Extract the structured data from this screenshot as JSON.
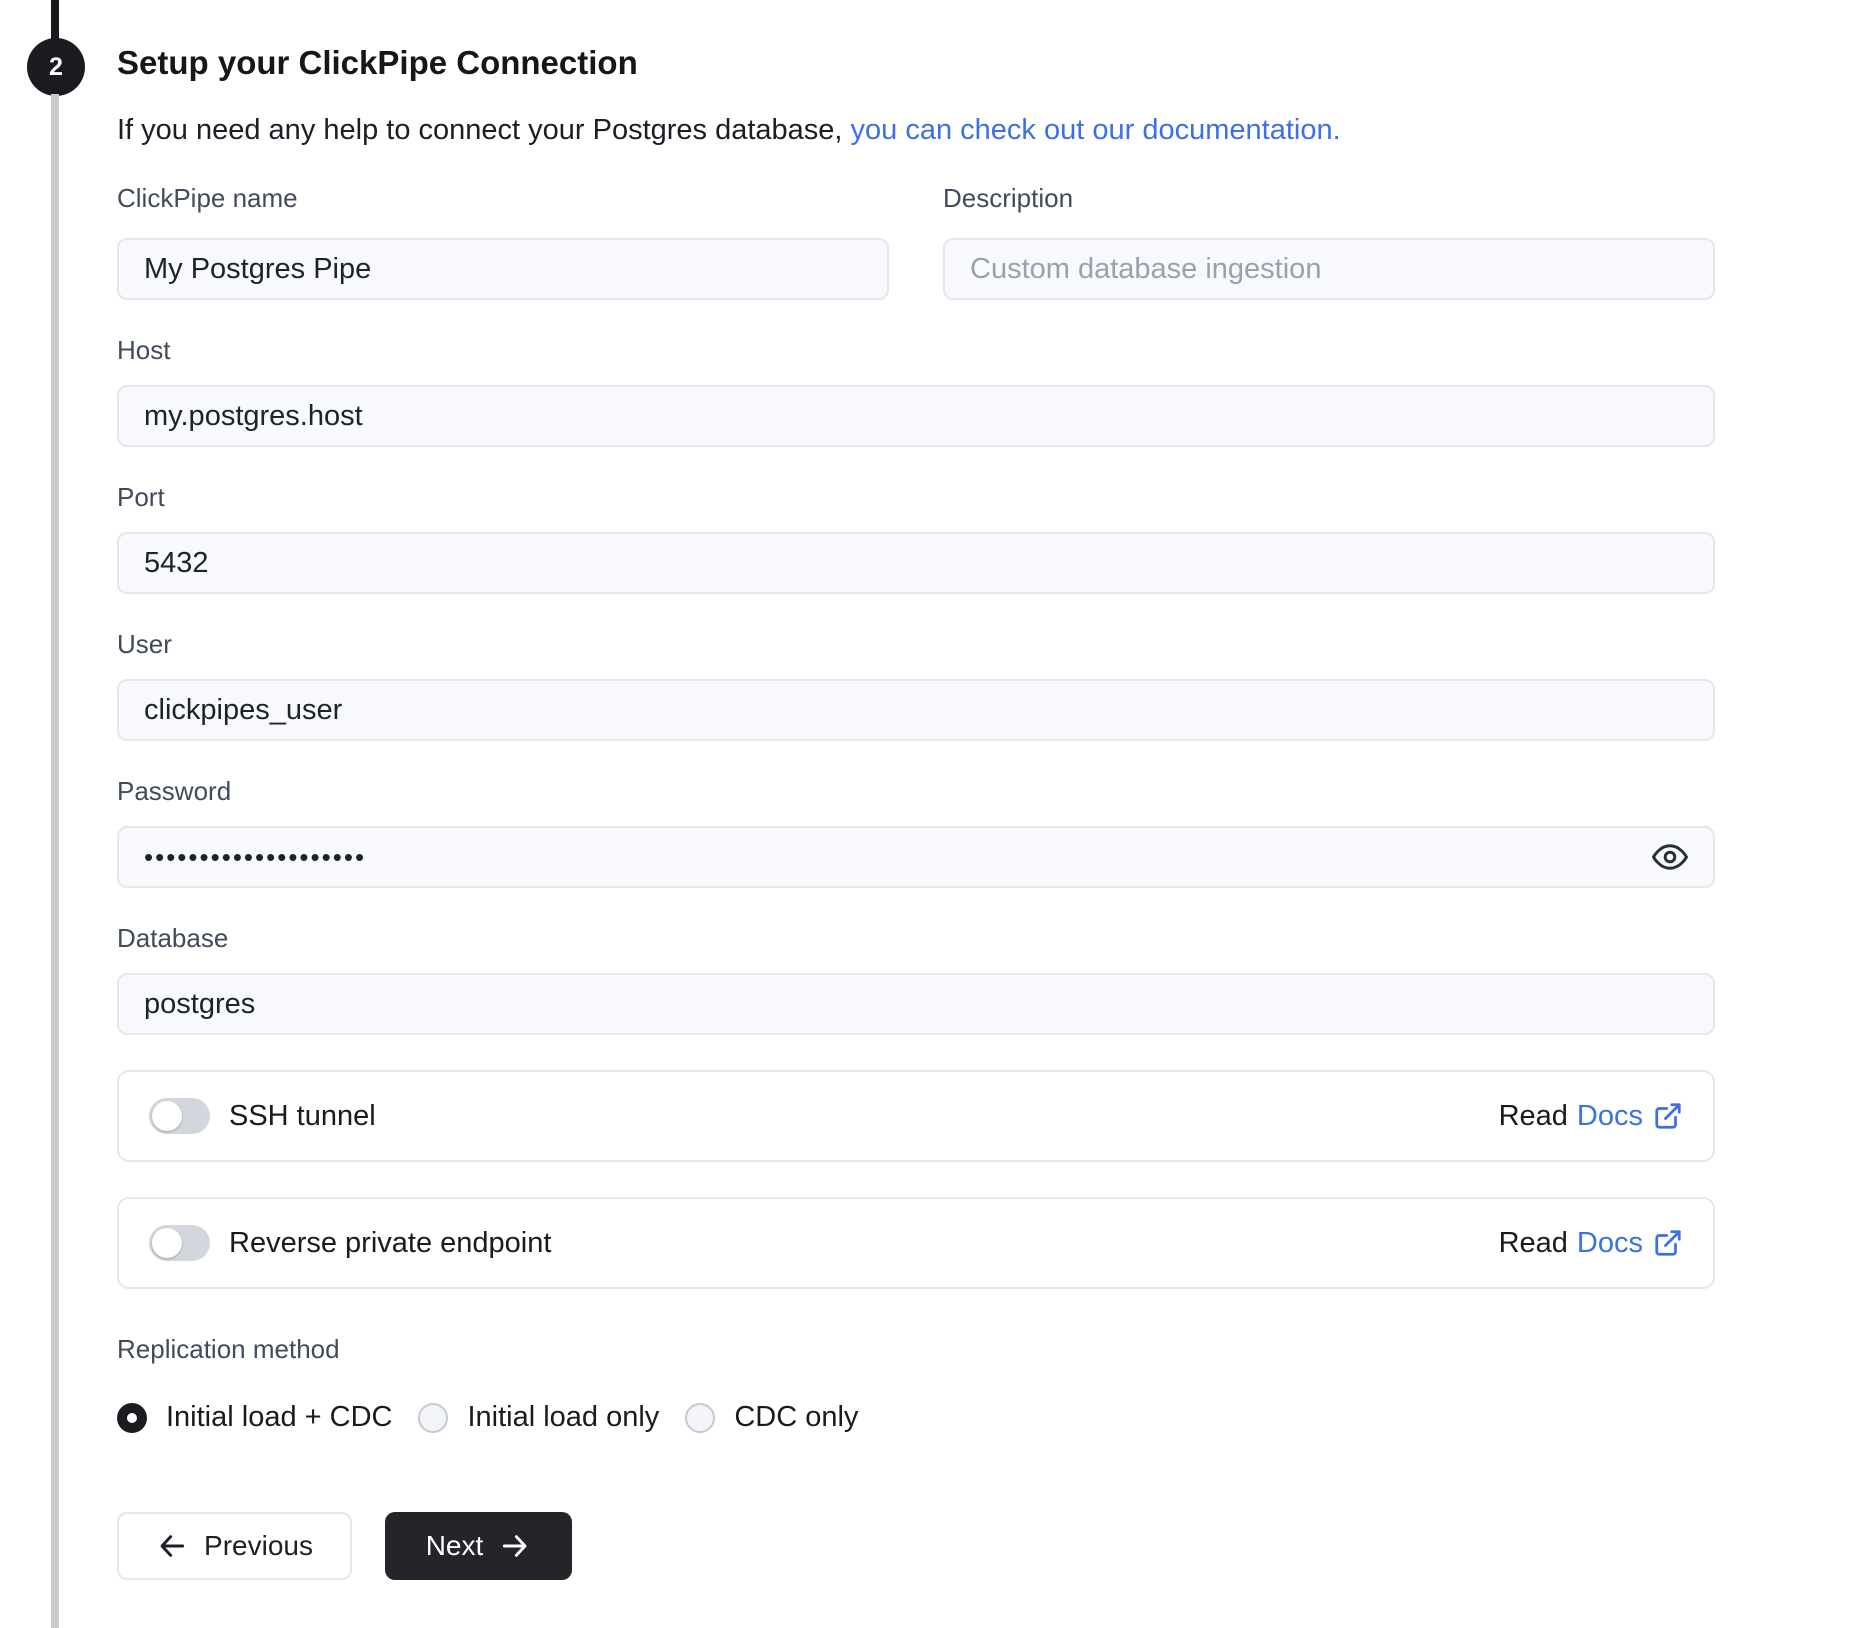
{
  "step": {
    "number": "2"
  },
  "header": {
    "title": "Setup your ClickPipe Connection",
    "subtitle_plain": "If you need any help to connect your Postgres database, ",
    "subtitle_link": "you can check out our documentation."
  },
  "fields": {
    "clickpipe_name": {
      "label": "ClickPipe name",
      "value": "My Postgres Pipe"
    },
    "description": {
      "label": "Description",
      "placeholder": "Custom database ingestion"
    },
    "host": {
      "label": "Host",
      "value": "my.postgres.host"
    },
    "port": {
      "label": "Port",
      "value": "5432"
    },
    "user": {
      "label": "User",
      "value": "clickpipes_user"
    },
    "password": {
      "label": "Password",
      "masked_value": "••••••••••••••••••••"
    },
    "database": {
      "label": "Database",
      "value": "postgres"
    }
  },
  "toggles": [
    {
      "label": "SSH tunnel",
      "state": "off",
      "read_label": "Read",
      "docs_label": "Docs"
    },
    {
      "label": "Reverse private endpoint",
      "state": "off",
      "read_label": "Read",
      "docs_label": "Docs"
    }
  ],
  "replication": {
    "label": "Replication method",
    "options": [
      {
        "label": "Initial load + CDC",
        "selected": true
      },
      {
        "label": "Initial load only",
        "selected": false
      },
      {
        "label": "CDC only",
        "selected": false
      }
    ]
  },
  "actions": {
    "previous_label": "Previous",
    "next_label": "Next"
  },
  "icons": {
    "password_reveal": "eye-icon",
    "docs_link": "external-link-icon",
    "previous": "arrow-left-icon",
    "next": "arrow-right-icon"
  },
  "colors": {
    "accent_blue": "#3b70e8",
    "dark_button": "#242529",
    "step_circle": "#1a1b1f",
    "toggle_track_off": "#d3d6dc",
    "input_background": "#f8f9fc"
  }
}
